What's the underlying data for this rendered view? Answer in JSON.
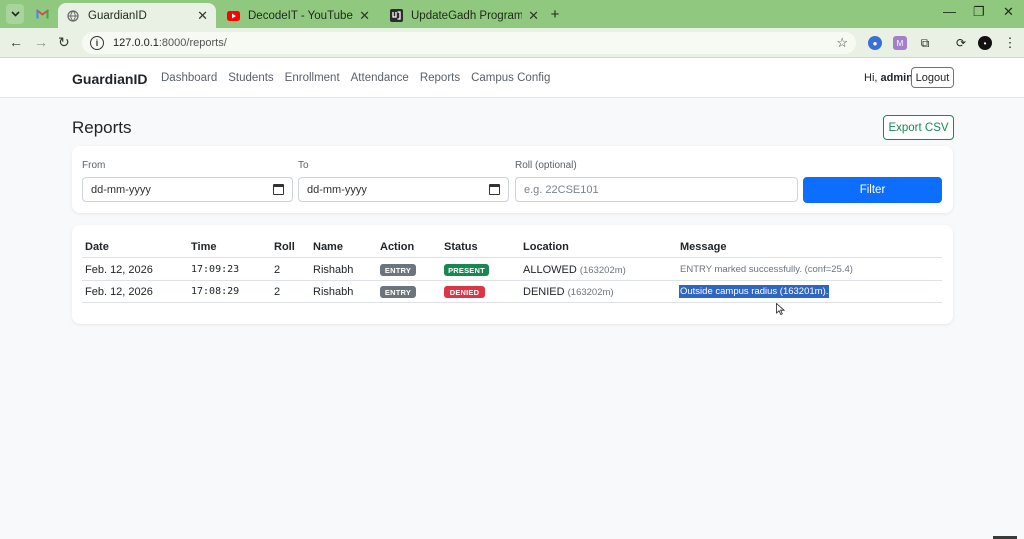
{
  "browser": {
    "tabs": [
      {
        "title": "GuardianID",
        "active": true
      },
      {
        "title": "DecodeIT - YouTube",
        "active": false
      },
      {
        "title": "UpdateGadh Programming - Up",
        "active": false
      }
    ],
    "new_tab": "+",
    "url_host": "127.0.0.1",
    "url_path": ":8000/reports/",
    "colors": {
      "tabstrip": "#8fc87e",
      "toolbar": "#e9f1e4"
    }
  },
  "app": {
    "brand": "GuardianID",
    "nav": [
      "Dashboard",
      "Students",
      "Enrollment",
      "Attendance",
      "Reports",
      "Campus Config"
    ],
    "greeting_prefix": "Hi,",
    "username": "admin",
    "logout_label": "Logout"
  },
  "page": {
    "title": "Reports",
    "export_label": "Export CSV"
  },
  "filters": {
    "from_label": "From",
    "from_value": "dd-mm-yyyy",
    "to_label": "To",
    "to_value": "dd-mm-yyyy",
    "roll_label": "Roll (optional)",
    "roll_placeholder": "e.g. 22CSE101",
    "filter_label": "Filter"
  },
  "table": {
    "headers": [
      "Date",
      "Time",
      "Roll",
      "Name",
      "Action",
      "Status",
      "Location",
      "Message"
    ],
    "rows": [
      {
        "date": "Feb. 12, 2026",
        "time": "17:09:23",
        "roll": "2",
        "name": "Rishabh",
        "action": "ENTRY",
        "status": "PRESENT",
        "location": "ALLOWED",
        "distance": "(163202m)",
        "message": "ENTRY marked successfully. (conf=25.4)"
      },
      {
        "date": "Feb. 12, 2026",
        "time": "17:08:29",
        "roll": "2",
        "name": "Rishabh",
        "action": "ENTRY",
        "status": "DENIED",
        "location": "DENIED",
        "distance": "(163202m)",
        "message": "Outside campus radius (163201m)."
      }
    ]
  },
  "colors": {
    "primary": "#0d6efd",
    "success": "#198754",
    "danger": "#dc3545",
    "secondary": "#6c757d",
    "selection": "#2f66c6"
  }
}
